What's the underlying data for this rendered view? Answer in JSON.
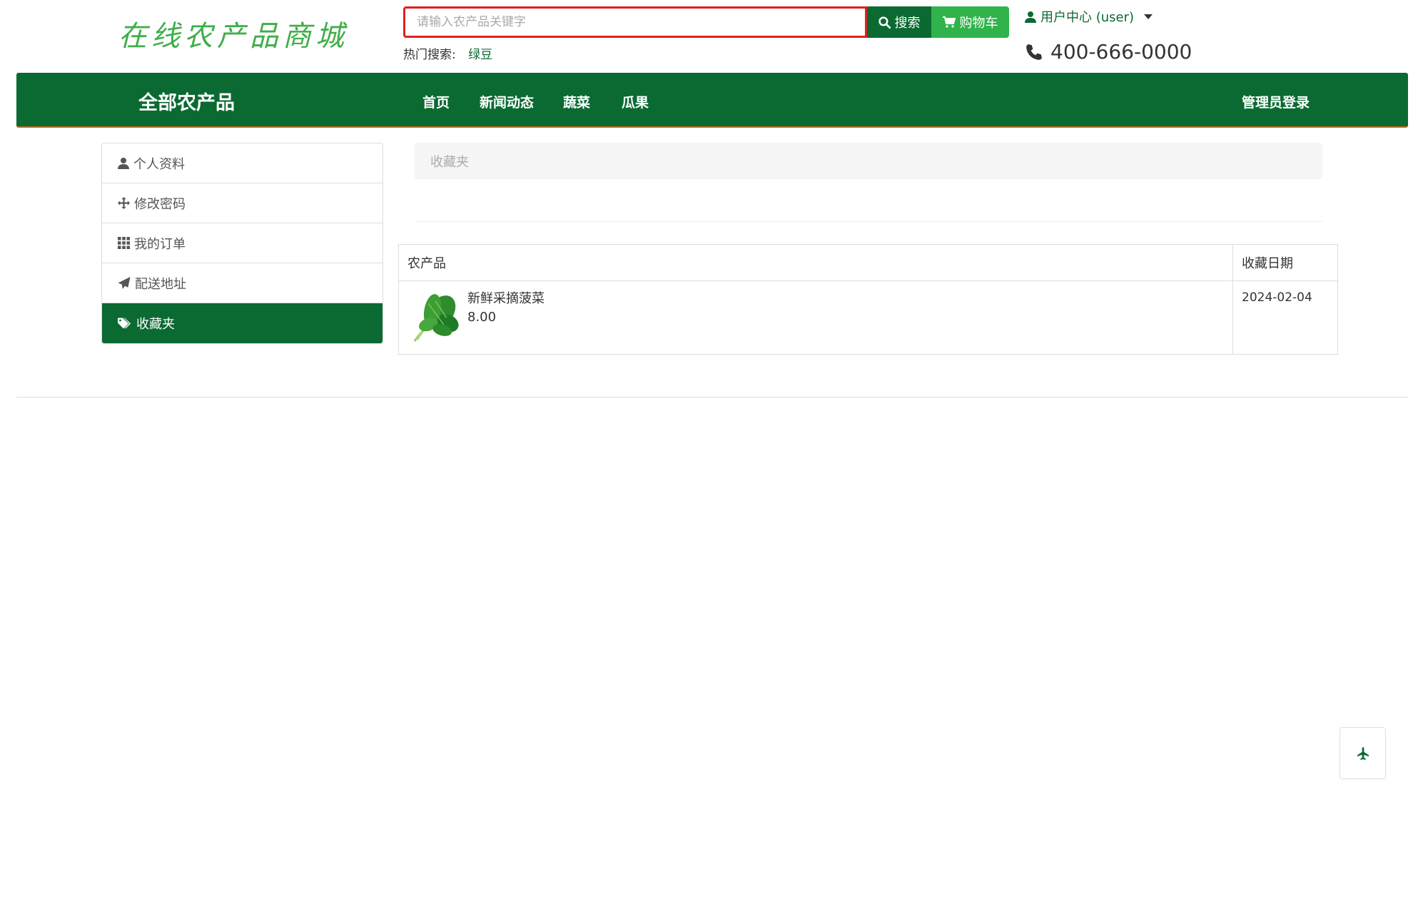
{
  "header": {
    "logo": "在线农产品商城",
    "search_placeholder": "请输入农产品关键字",
    "search_label": "搜索",
    "cart_label": "购物车",
    "hot_label": "热门搜索:",
    "hot_keyword": "绿豆",
    "user_label": "用户中心 (user)",
    "phone": "400-666-0000"
  },
  "nav": {
    "all_label": "全部农产品",
    "items": [
      "首页",
      "新闻动态",
      "蔬菜",
      "瓜果"
    ],
    "admin_label": "管理员登录"
  },
  "sidebar": {
    "items": [
      {
        "label": "个人资料",
        "icon": "user-icon"
      },
      {
        "label": "修改密码",
        "icon": "move-icon"
      },
      {
        "label": "我的订单",
        "icon": "grid-icon"
      },
      {
        "label": "配送地址",
        "icon": "send-icon"
      },
      {
        "label": "收藏夹",
        "icon": "tags-icon",
        "active": true
      }
    ]
  },
  "content": {
    "breadcrumb": "收藏夹",
    "table": {
      "headers": [
        "农产品",
        "收藏日期"
      ],
      "rows": [
        {
          "name": "新鲜采摘菠菜",
          "price": "8.00",
          "date": "2024-02-04"
        }
      ]
    }
  },
  "colors": {
    "brand": "#0a6a32",
    "cart": "#2fb34a",
    "logo": "#3fae49",
    "search_border": "#e02020"
  }
}
